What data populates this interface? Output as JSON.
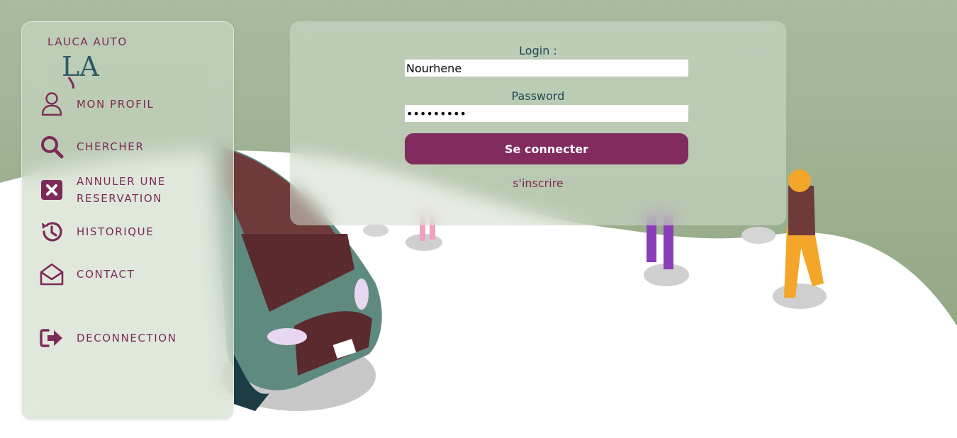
{
  "brand": {
    "name": "LAUCA AUTO",
    "logo_text": "LA"
  },
  "nav": {
    "items": [
      {
        "label": "MON PROFIL",
        "icon": "user-icon"
      },
      {
        "label": "CHERCHER",
        "icon": "search-icon"
      },
      {
        "label": "ANNULER UNE RESERVATION",
        "icon": "cancel-box-icon"
      },
      {
        "label": "HISTORIQUE",
        "icon": "history-icon"
      },
      {
        "label": "CONTACT",
        "icon": "envelope-open-icon"
      },
      {
        "label": "DECONNECTION",
        "icon": "sign-out-icon"
      }
    ]
  },
  "login": {
    "login_label": "Login :",
    "login_value": "Nourhene",
    "password_label": "Password",
    "password_value": "nourhene1",
    "submit_label": "Se connecter",
    "signup_label": "s'inscrire"
  },
  "colors": {
    "accent": "#822b5e",
    "label_teal": "#1e4a52",
    "background_green": "#98ad8c"
  }
}
